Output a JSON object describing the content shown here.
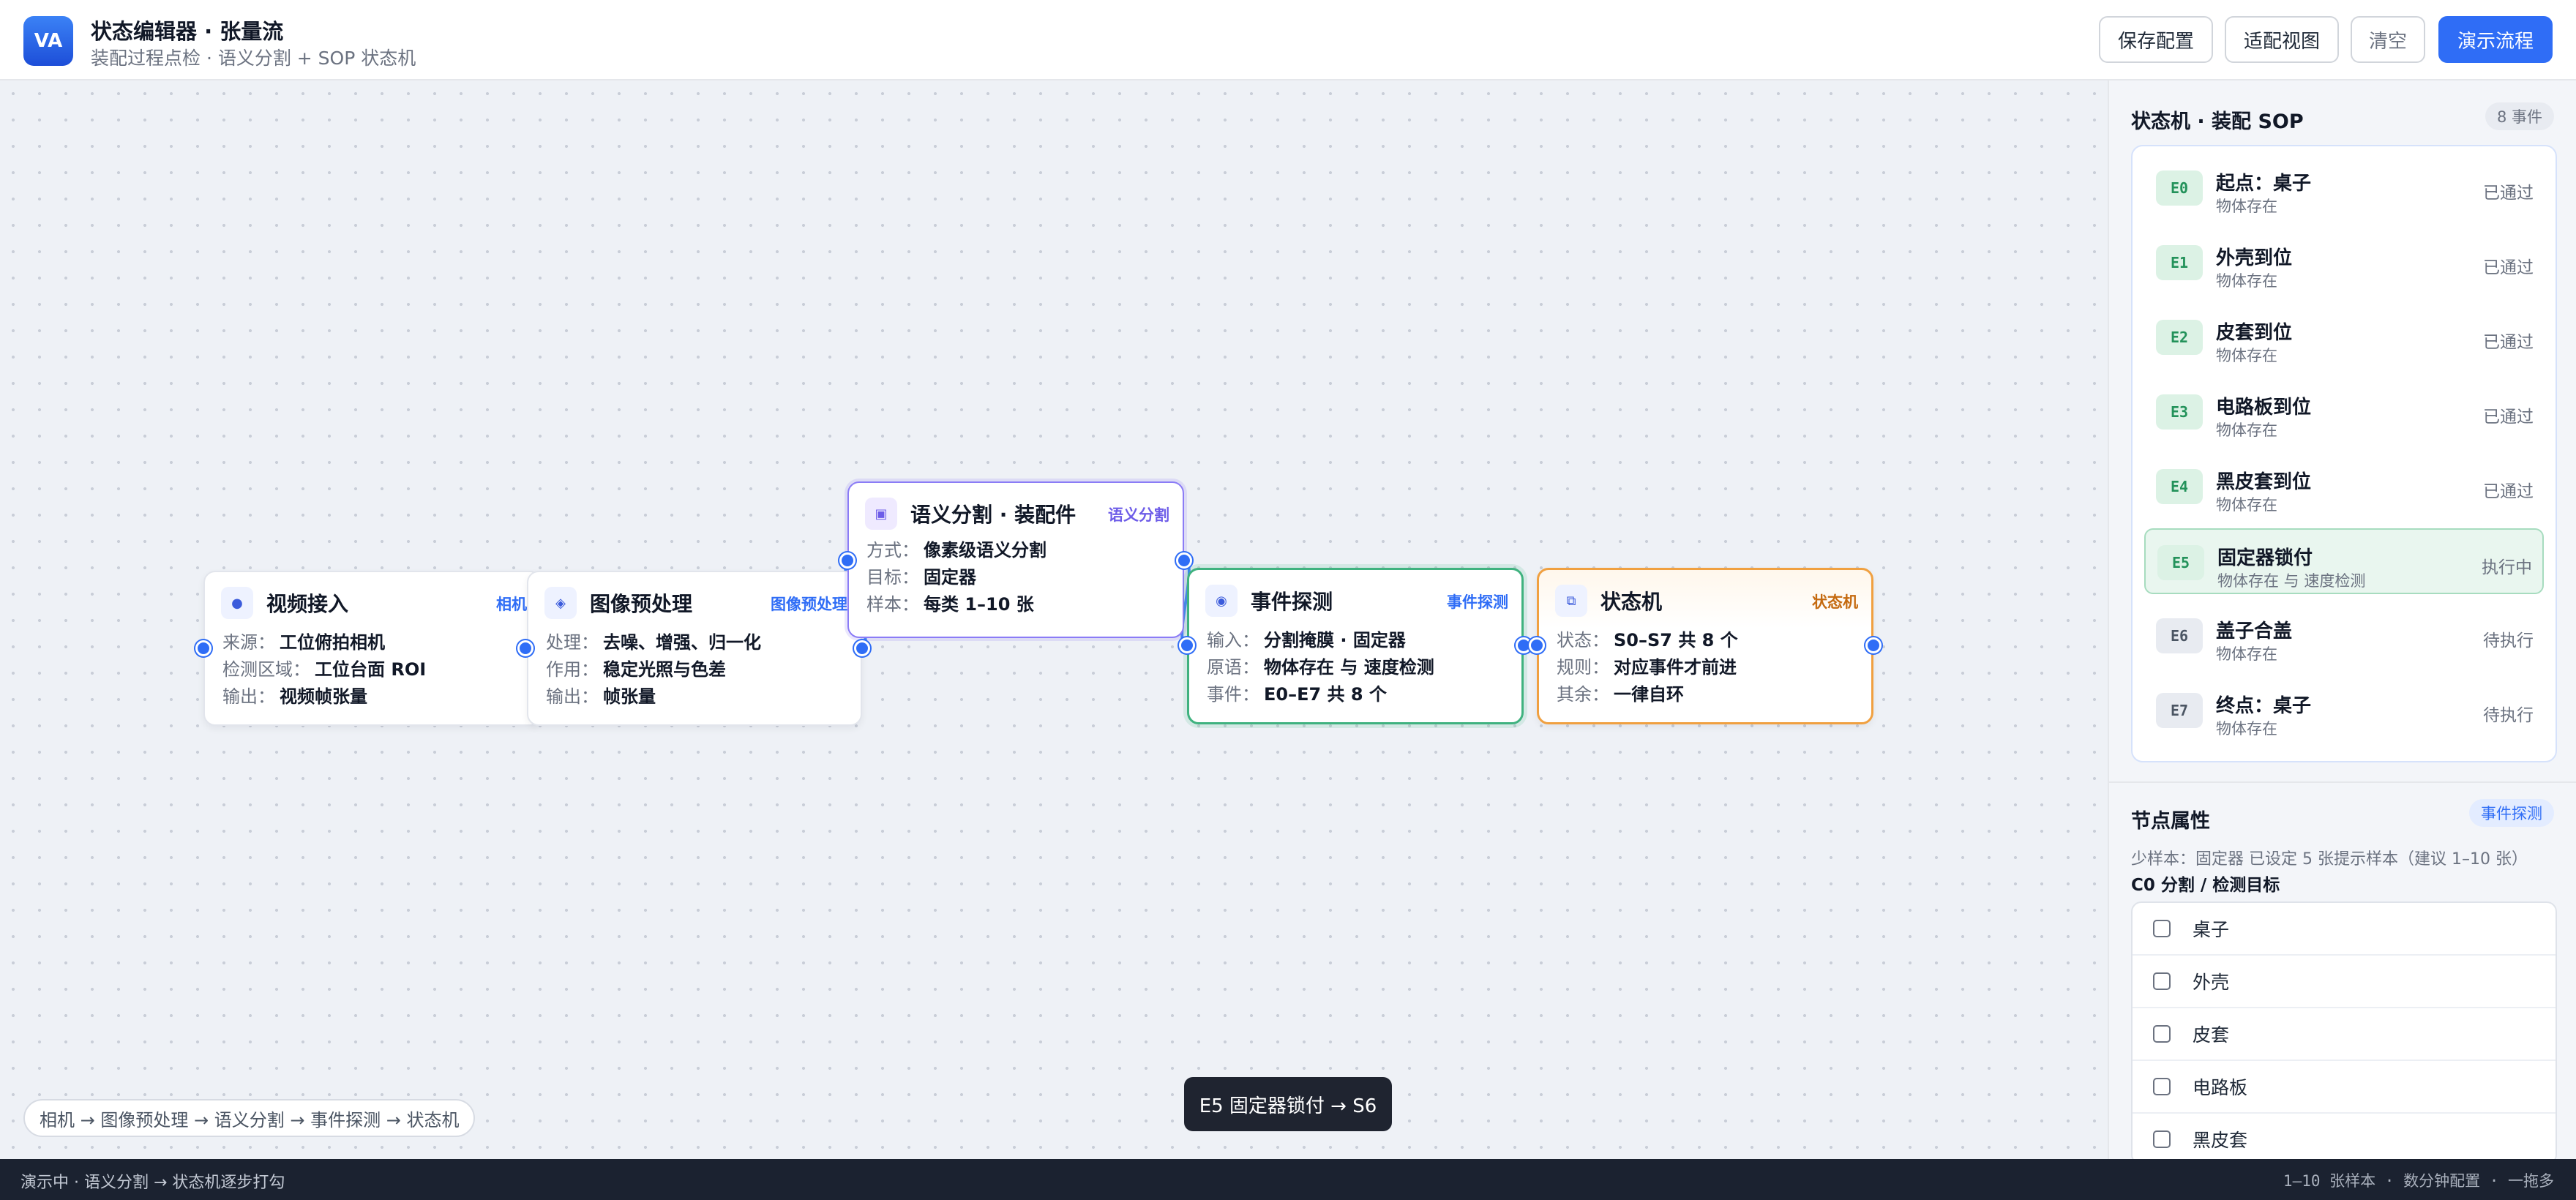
{
  "header": {
    "logo_text": "VA",
    "title": "状态编辑器 · 张量流",
    "subtitle": "装配过程点检 · 语义分割 + SOP 状态机",
    "buttons": {
      "save": "保存配置",
      "fit": "适配视图",
      "clear": "清空",
      "demo": "演示流程"
    }
  },
  "canvas": {
    "nodes": [
      {
        "title": "视频接入",
        "tag": "相机",
        "icon": "dot-icon",
        "rows": [
          {
            "k": "来源：",
            "v": "工位俯拍相机"
          },
          {
            "k": "检测区域：",
            "v": "工位台面 ROI"
          },
          {
            "k": "输出：",
            "v": "视频帧张量"
          }
        ]
      },
      {
        "title": "图像预处理",
        "tag": "图像预处理",
        "icon": "diamond-icon",
        "rows": [
          {
            "k": "处理：",
            "v": "去噪、增强、归一化"
          },
          {
            "k": "作用：",
            "v": "稳定光照与色差"
          },
          {
            "k": "输出：",
            "v": "帧张量"
          }
        ]
      },
      {
        "title": "语义分割 · 装配件",
        "tag": "语义分割",
        "icon": "square-icon",
        "rows": [
          {
            "k": "方式：",
            "v": "像素级语义分割"
          },
          {
            "k": "目标：",
            "v": "固定器"
          },
          {
            "k": "样本：",
            "v": "每类 1–10 张"
          }
        ]
      },
      {
        "title": "事件探测",
        "tag": "事件探测",
        "icon": "eye-icon",
        "rows": [
          {
            "k": "输入：",
            "v": "分割掩膜 · 固定器"
          },
          {
            "k": "原语：",
            "v": "物体存在 与 速度检测"
          },
          {
            "k": "事件：",
            "v": "E0–E7 共 8 个"
          }
        ]
      },
      {
        "title": "状态机",
        "tag": "状态机",
        "icon": "state-machine-icon",
        "rows": [
          {
            "k": "状态：",
            "v": "S0–S7 共 8 个"
          },
          {
            "k": "规则：",
            "v": "对应事件才前进"
          },
          {
            "k": "其余：",
            "v": "一律自环"
          }
        ]
      }
    ],
    "toast": "E5 固定器锁付 → S6",
    "breadcrumb": "相机 → 图像预处理 → 语义分割 → 事件探测 → 状态机"
  },
  "panel": {
    "title": "状态机 · 装配 SOP",
    "count_badge": "8 事件",
    "events": [
      {
        "code": "E0",
        "title": "起点：桌子",
        "desc": "物体存在",
        "status": "已通过",
        "state": "done"
      },
      {
        "code": "E1",
        "title": "外壳到位",
        "desc": "物体存在",
        "status": "已通过",
        "state": "done"
      },
      {
        "code": "E2",
        "title": "皮套到位",
        "desc": "物体存在",
        "status": "已通过",
        "state": "done"
      },
      {
        "code": "E3",
        "title": "电路板到位",
        "desc": "物体存在",
        "status": "已通过",
        "state": "done"
      },
      {
        "code": "E4",
        "title": "黑皮套到位",
        "desc": "物体存在",
        "status": "已通过",
        "state": "done"
      },
      {
        "code": "E5",
        "title": "固定器锁付",
        "desc": "物体存在 与 速度检测",
        "status": "执行中",
        "state": "active"
      },
      {
        "code": "E6",
        "title": "盖子合盖",
        "desc": "物体存在",
        "status": "待执行",
        "state": "todo"
      },
      {
        "code": "E7",
        "title": "终点：桌子",
        "desc": "物体存在",
        "status": "待执行",
        "state": "todo"
      }
    ],
    "props": {
      "title": "节点属性",
      "kind_badge": "事件探测",
      "note": "少样本：固定器 已设定 5 张提示样本（建议 1–10 张）",
      "subtitle": "C0 分割 / 检测目标",
      "targets": [
        "桌子",
        "外壳",
        "皮套",
        "电路板",
        "黑皮套"
      ]
    }
  },
  "footer": {
    "left": "演示中 · 语义分割 → 状态机逐步打勾",
    "right": "1–10 张样本 · 数分钟配置 · 一拖多"
  },
  "colors": {
    "accent": "#2f6df6",
    "success": "#3fb27f",
    "warning": "#f0a040",
    "segment": "#8b7cf6"
  }
}
